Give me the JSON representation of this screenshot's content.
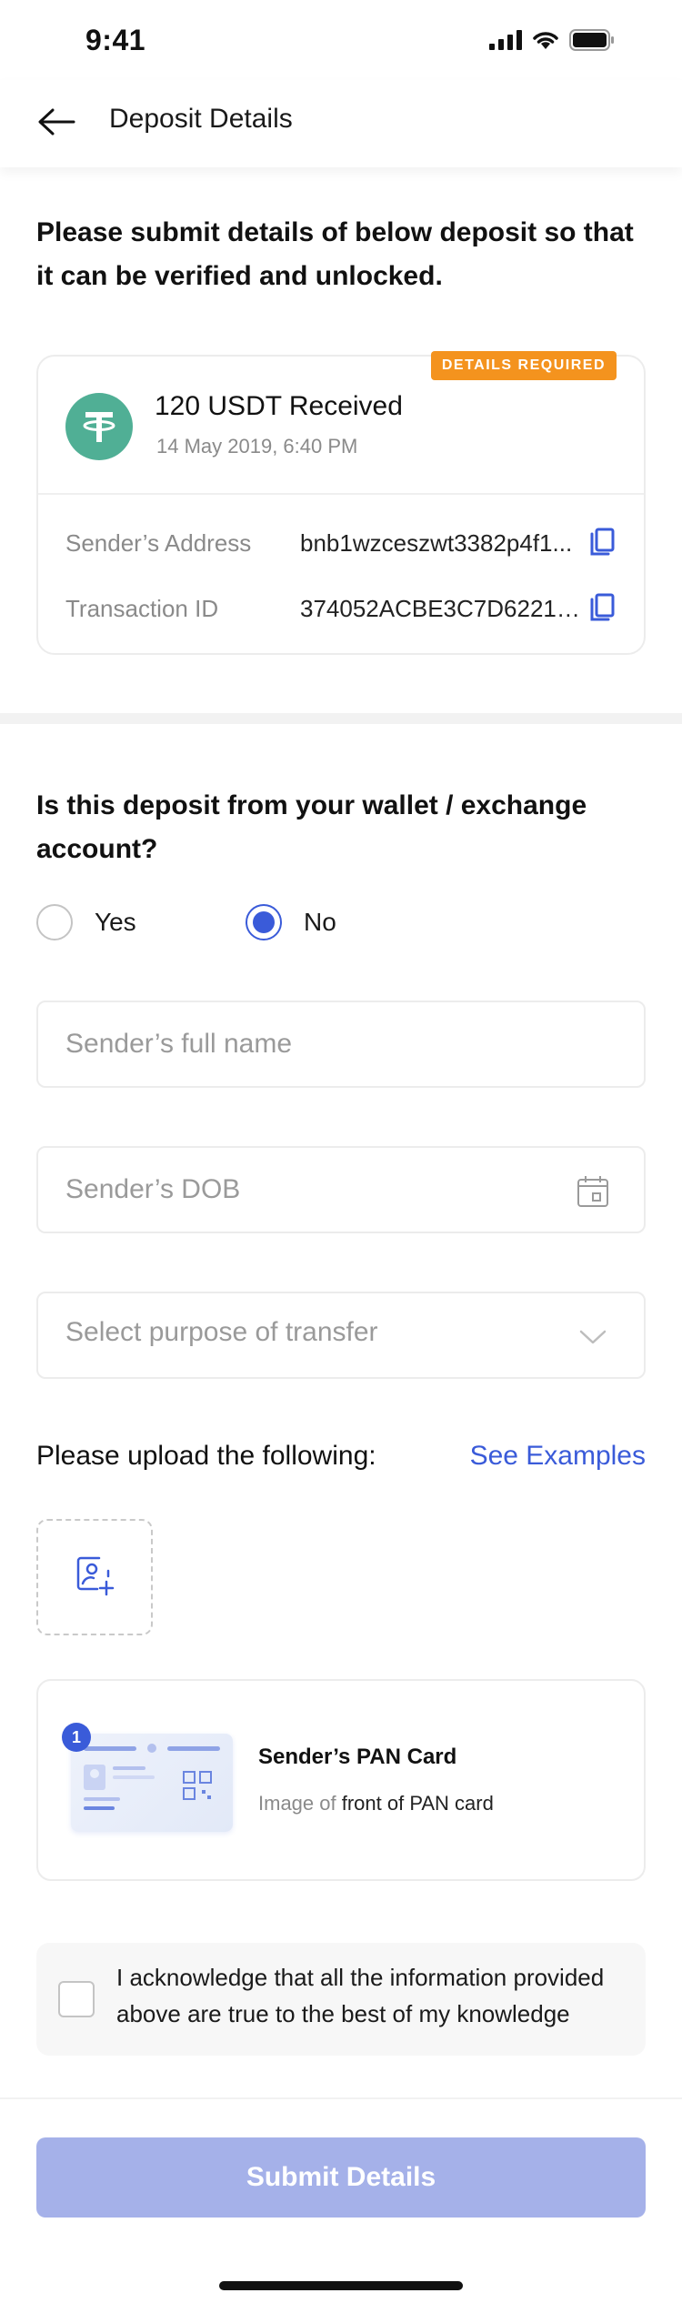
{
  "status_bar": {
    "time": "9:41"
  },
  "header": {
    "title": "Deposit Details"
  },
  "intro": {
    "text": "Please submit details of below deposit so that  it can be verified and unlocked."
  },
  "deposit": {
    "badge": "DETAILS REQUIRED",
    "title": "120 USDT Received",
    "date": "14 May 2019, 6:40 PM",
    "rows": [
      {
        "label": "Sender’s Address",
        "value": "bnb1wzceszwt3382p4f1..."
      },
      {
        "label": "Transaction ID",
        "value": "374052ACBE3C7D6221A..."
      }
    ],
    "coin_color": "#50af95"
  },
  "question": {
    "text": "Is this deposit from your wallet / exchange account?",
    "options": [
      {
        "label": "Yes",
        "selected": false
      },
      {
        "label": "No",
        "selected": true
      }
    ]
  },
  "form": {
    "name_placeholder": "Sender’s full name",
    "dob_placeholder": "Sender’s DOB",
    "purpose_placeholder": "Select purpose of transfer"
  },
  "upload": {
    "title": "Please upload the following:",
    "link": "See Examples"
  },
  "document": {
    "index": "1",
    "title": "Sender’s PAN Card",
    "sub_prefix": "Image of",
    "sub_main": "front of PAN card"
  },
  "acknowledge": {
    "text": "I acknowledge that all the information provided above are true to the best of my knowledge",
    "checked": false
  },
  "submit": {
    "label": "Submit Details"
  },
  "colors": {
    "accent": "#3a5bd9",
    "badge": "#f4931e",
    "submit_disabled": "#a5b1e9"
  }
}
